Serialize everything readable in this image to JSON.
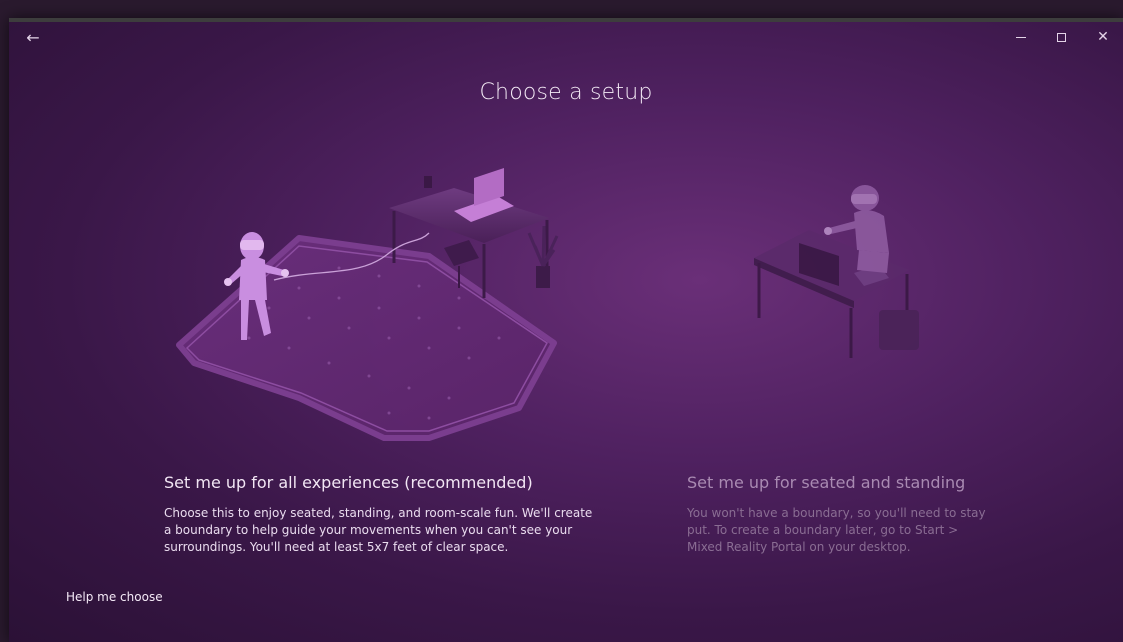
{
  "window": {
    "back_label": "←",
    "close_label": "✕"
  },
  "page": {
    "title": "Choose a setup"
  },
  "options": [
    {
      "title": "Set me up for all experiences (recommended)",
      "description": "Choose this to enjoy seated, standing, and room-scale fun. We'll create a boundary to help guide your movements when you can't see your surroundings. You'll need at least 5x7 feet of clear space."
    },
    {
      "title": "Set me up for seated and standing",
      "description": "You won't have a boundary, so you'll need to stay put. To create a boundary later, go to Start > Mixed Reality Portal on your desktop."
    }
  ],
  "help_link": "Help me choose",
  "colors": {
    "background": "#4f2160",
    "accent": "#c08fd0"
  },
  "icons": {
    "back": "back-arrow-icon",
    "minimize": "minimize-icon",
    "maximize": "maximize-icon",
    "close": "close-icon"
  }
}
